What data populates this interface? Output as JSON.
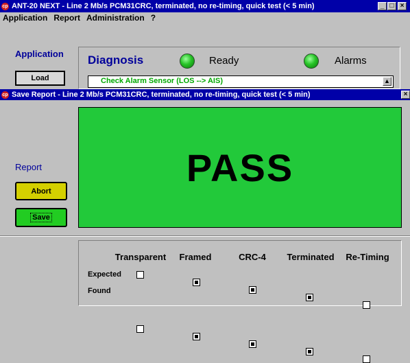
{
  "main_window": {
    "title": "ANT-20 NEXT - Line 2 Mb/s PCM31CRC, terminated, no re-timing, quick test (< 5 min)",
    "menu": [
      "Application",
      "Report",
      "Administration",
      "?"
    ],
    "controls": {
      "minimize": "_",
      "maximize": "□",
      "close": "×"
    }
  },
  "application_panel": {
    "label": "Application",
    "load_button": "Load"
  },
  "diagnosis": {
    "title": "Diagnosis",
    "ready_label": "Ready",
    "alarms_label": "Alarms",
    "led_color": "#28c428",
    "step_text": "Check Alarm Sensor (LOS --> AIS)"
  },
  "save_window": {
    "title": "Save Report - Line 2 Mb/s PCM31CRC, terminated, no re-timing, quick test (< 5 min)",
    "close": "×"
  },
  "report_panel": {
    "label": "Report",
    "abort_button": "Abort",
    "save_button": "Save",
    "abort_color": "#d4d000",
    "save_color": "#22cc22"
  },
  "result": {
    "text": "PASS",
    "color": "#22c93a"
  },
  "config_table": {
    "columns": [
      "Transparent",
      "Framed",
      "CRC-4",
      "Terminated",
      "Re-Timing"
    ],
    "rows": [
      {
        "label": "Expected",
        "values": [
          false,
          true,
          true,
          true,
          false
        ]
      },
      {
        "label": "Found",
        "values": [
          false,
          true,
          true,
          true,
          false
        ]
      }
    ]
  }
}
